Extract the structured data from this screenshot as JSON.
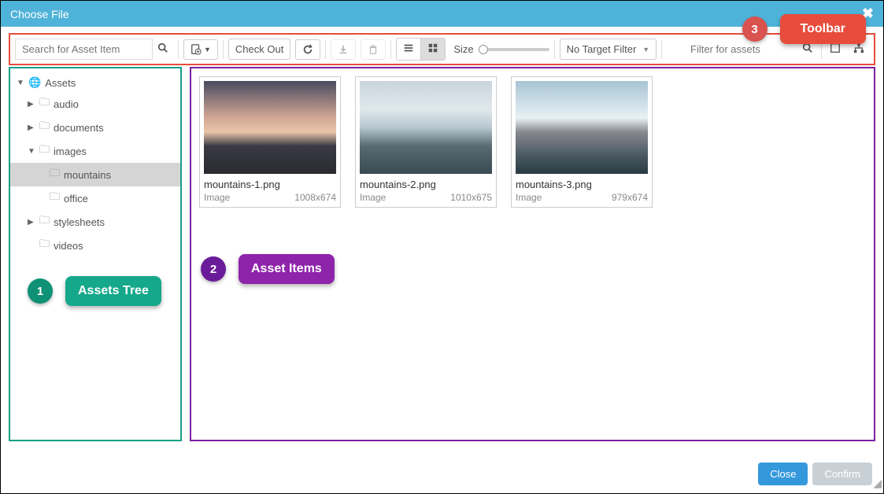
{
  "header": {
    "title": "Choose File"
  },
  "toolbar": {
    "search_placeholder": "Search for Asset Item",
    "checkout_label": "Check Out",
    "size_label": "Size",
    "target_filter_label": "No Target Filter",
    "filter_placeholder": "Filter for assets"
  },
  "tree": {
    "root": "Assets",
    "items": [
      {
        "label": "audio",
        "expanded": false,
        "hasChildren": true
      },
      {
        "label": "documents",
        "expanded": false,
        "hasChildren": true
      },
      {
        "label": "images",
        "expanded": true,
        "hasChildren": true
      },
      {
        "label": "mountains",
        "indent": 2,
        "selected": true
      },
      {
        "label": "office",
        "indent": 2
      },
      {
        "label": "stylesheets",
        "expanded": false,
        "hasChildren": true
      },
      {
        "label": "videos",
        "expanded": false,
        "hasChildren": false
      }
    ]
  },
  "assets": [
    {
      "name": "mountains-1.png",
      "type": "Image",
      "dims": "1008x674"
    },
    {
      "name": "mountains-2.png",
      "type": "Image",
      "dims": "1010x675"
    },
    {
      "name": "mountains-3.png",
      "type": "Image",
      "dims": "979x674"
    }
  ],
  "annotations": {
    "a1": {
      "num": "1",
      "label": "Assets Tree"
    },
    "a2": {
      "num": "2",
      "label": "Asset Items"
    },
    "a3": {
      "num": "3",
      "label": "Toolbar"
    }
  },
  "footer": {
    "close": "Close",
    "confirm": "Confirm"
  }
}
